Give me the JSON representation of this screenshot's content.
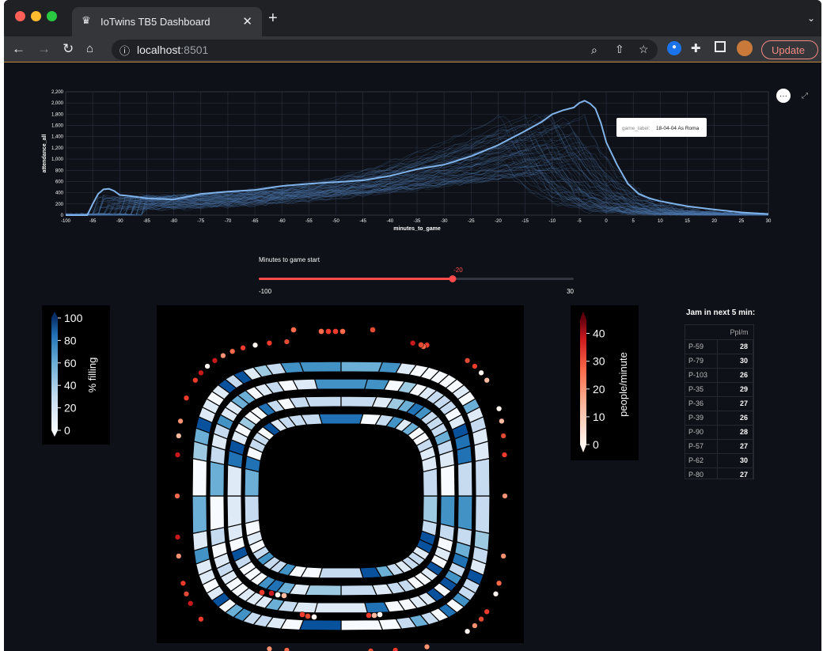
{
  "browser": {
    "tab_title": "IoTwins TB5 Dashboard",
    "tab_close": "✕",
    "new_tab": "+",
    "tab_menu": "⌄",
    "url_host": "localhost",
    "url_port": ":8501",
    "update_label": "Update",
    "colors": {
      "titlebar": "#202124",
      "toolbar": "#35363a",
      "close": "#ff5f57",
      "minimize": "#febc2e",
      "maximize": "#28c840",
      "update": "#f28b82"
    },
    "icons": [
      "back-arrow-icon",
      "forward-arrow-icon",
      "reload-icon",
      "home-icon",
      "info-icon",
      "zoom-icon",
      "share-icon",
      "star-icon",
      "extension-pin-icon",
      "puzzle-icon",
      "sidebar-icon",
      "profile-avatar-icon",
      "menu-kebab-icon"
    ]
  },
  "chart_data": [
    {
      "type": "line",
      "xlabel": "minutes_to_game",
      "ylabel": "attendance_all",
      "xlim": [
        -100,
        30
      ],
      "ylim": [
        0,
        2200
      ],
      "xticks": [
        -100,
        -95,
        -90,
        -85,
        -80,
        -75,
        -70,
        -65,
        -60,
        -55,
        -50,
        -45,
        -40,
        -35,
        -30,
        -25,
        -20,
        -15,
        -10,
        -5,
        0,
        5,
        10,
        15,
        20,
        25,
        30
      ],
      "yticks": [
        "0",
        "200",
        "400",
        "600",
        "800",
        "1,000",
        "1,200",
        "1,400",
        "1,600",
        "1,800",
        "2,000",
        "2,200"
      ],
      "grid": true,
      "highlight_series": {
        "name": "18-04-04 As Roma",
        "x": [
          -100,
          -96,
          -95,
          -94,
          -93,
          -92,
          -91,
          -90,
          -88,
          -85,
          -80,
          -75,
          -70,
          -65,
          -60,
          -55,
          -50,
          -45,
          -40,
          -35,
          -30,
          -25,
          -20,
          -15,
          -12,
          -10,
          -8,
          -6,
          -5,
          -4,
          -3,
          -2,
          -1,
          0,
          2,
          4,
          6,
          8,
          10,
          15,
          20,
          25,
          30
        ],
        "y": [
          0,
          0,
          200,
          380,
          460,
          470,
          430,
          360,
          340,
          300,
          280,
          380,
          420,
          450,
          520,
          560,
          590,
          620,
          700,
          820,
          900,
          1050,
          1250,
          1500,
          1660,
          1800,
          1870,
          1920,
          2000,
          2040,
          1990,
          1900,
          1650,
          1300,
          900,
          560,
          380,
          300,
          250,
          160,
          100,
          50,
          20
        ]
      },
      "tooltip": {
        "label": "game_label:",
        "value": "18-04-04 As Roma"
      },
      "background_series_count": 60
    },
    {
      "type": "heatmap",
      "description_label": "% filling",
      "colorbar_ticks": [
        "100",
        "80",
        "60",
        "40",
        "20",
        "0"
      ],
      "range": [
        0,
        100
      ]
    },
    {
      "type": "heatmap",
      "description_label": "people/minute",
      "colorbar_ticks": [
        "40",
        "30",
        "20",
        "10",
        "0"
      ],
      "range": [
        0,
        45
      ]
    }
  ],
  "slider": {
    "label": "Minutes to game start",
    "value": "-20",
    "min_label": "-100",
    "max_label": "30",
    "min": -100,
    "max": 30,
    "current": -20,
    "color": "#ff4b4b"
  },
  "jam": {
    "title": "Jam in next 5 min:",
    "column": "Ppl/m",
    "rows": [
      {
        "id": "P-59",
        "value": "28"
      },
      {
        "id": "P-79",
        "value": "30"
      },
      {
        "id": "P-103",
        "value": "26"
      },
      {
        "id": "P-35",
        "value": "29"
      },
      {
        "id": "P-36",
        "value": "27"
      },
      {
        "id": "P-39",
        "value": "26"
      },
      {
        "id": "P-90",
        "value": "28"
      },
      {
        "id": "P-57",
        "value": "27"
      },
      {
        "id": "P-62",
        "value": "30"
      },
      {
        "id": "P-80",
        "value": "27"
      }
    ]
  }
}
